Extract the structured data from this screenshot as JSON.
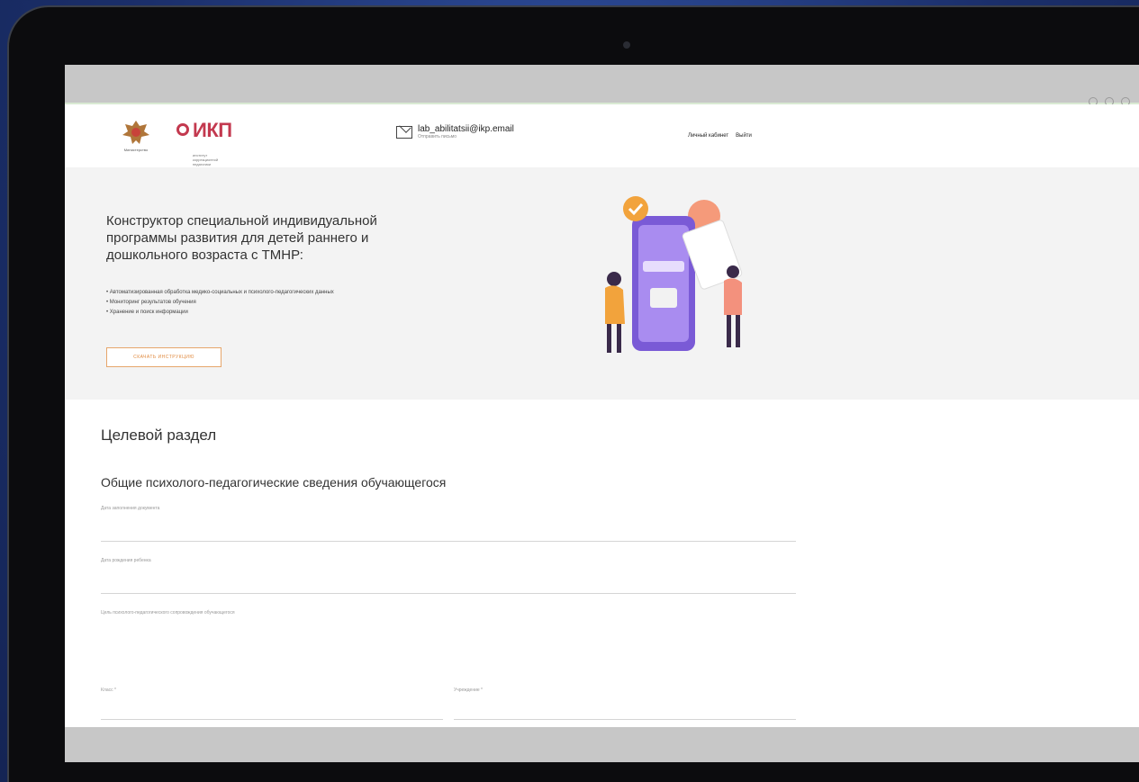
{
  "header": {
    "emblem_caption": "Министерство",
    "ikp_logo": "ИКП",
    "ikp_sub": "институт коррекционной педагогики",
    "email": "lab_abilitatsii@ikp.email",
    "email_sub": "Отправить письмо",
    "links": [
      "Личный кабинет",
      "Выйти"
    ]
  },
  "hero": {
    "title": "Конструктор специальной индивидуальной программы развития для детей раннего и дошкольного возраста с ТМНР:",
    "bullets": [
      "• Автоматизированная обработка медико-социальных и психолого-педагогических данных",
      "• Мониторинг результатов обучения",
      "• Хранение и поиск информации"
    ],
    "button_label": "СКАЧАТЬ ИНСТРУКЦИЮ"
  },
  "section": {
    "title": "Целевой раздел",
    "subtitle": "Общие психолого-педагогические сведения обучающегося"
  },
  "fields": [
    {
      "label": "Дата заполнения документа"
    },
    {
      "label": "Дата рождения ребенка"
    },
    {
      "label": "Цель психолого-педагогического сопровождения обучающегося"
    },
    {
      "label": "Класс *"
    },
    {
      "label": "Учреждение *"
    }
  ],
  "colors": {
    "accent_orange": "#e08a3f",
    "ikp_red": "#c3394f",
    "phone_purple": "#8f6fe0"
  }
}
